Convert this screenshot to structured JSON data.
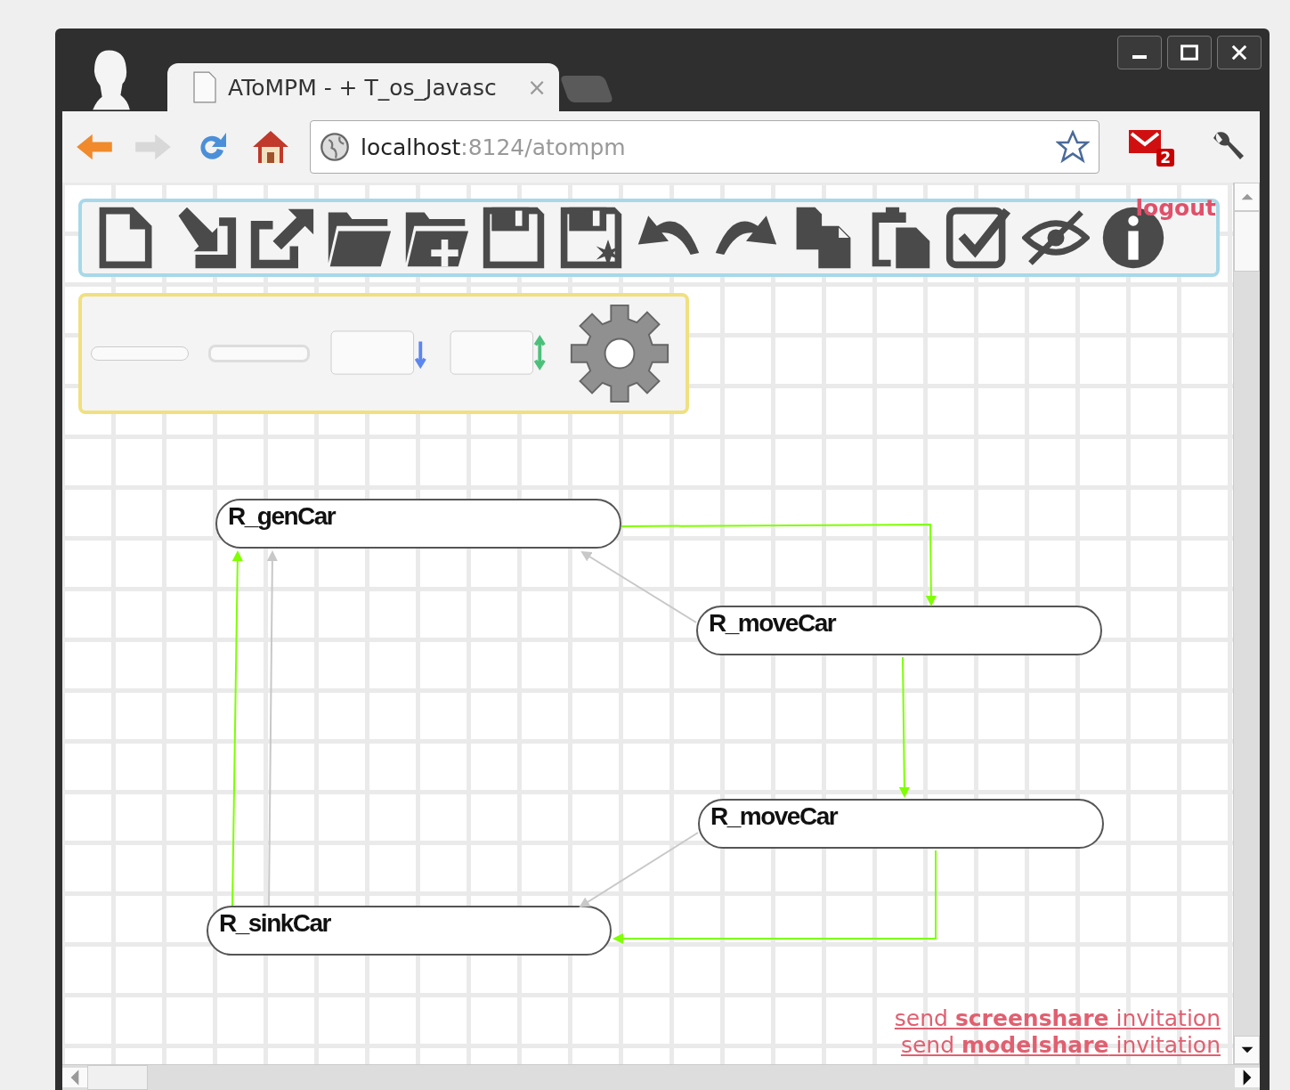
{
  "browser": {
    "tab_title": "AToMPM - + T_os_Javasc",
    "tab_close": "×",
    "url_host": "localhost",
    "url_path": ":8124/atompm",
    "mail_count": "2"
  },
  "toolbar": {
    "logout": "logout"
  },
  "nodes": [
    {
      "label": "R_genCar"
    },
    {
      "label": "R_moveCar"
    },
    {
      "label": "R_moveCar"
    },
    {
      "label": "R_sinkCar"
    }
  ],
  "edges": [
    {
      "color": "#7fff00"
    },
    {
      "color": "#c8c8c8"
    },
    {
      "color": "#7fff00"
    },
    {
      "color": "#c8c8c8"
    },
    {
      "color": "#7fff00"
    },
    {
      "color": "#7fff00"
    },
    {
      "color": "#c8c8c8"
    }
  ],
  "links": [
    "send **screenshare** invitation",
    "send **modelshare** invitation"
  ]
}
